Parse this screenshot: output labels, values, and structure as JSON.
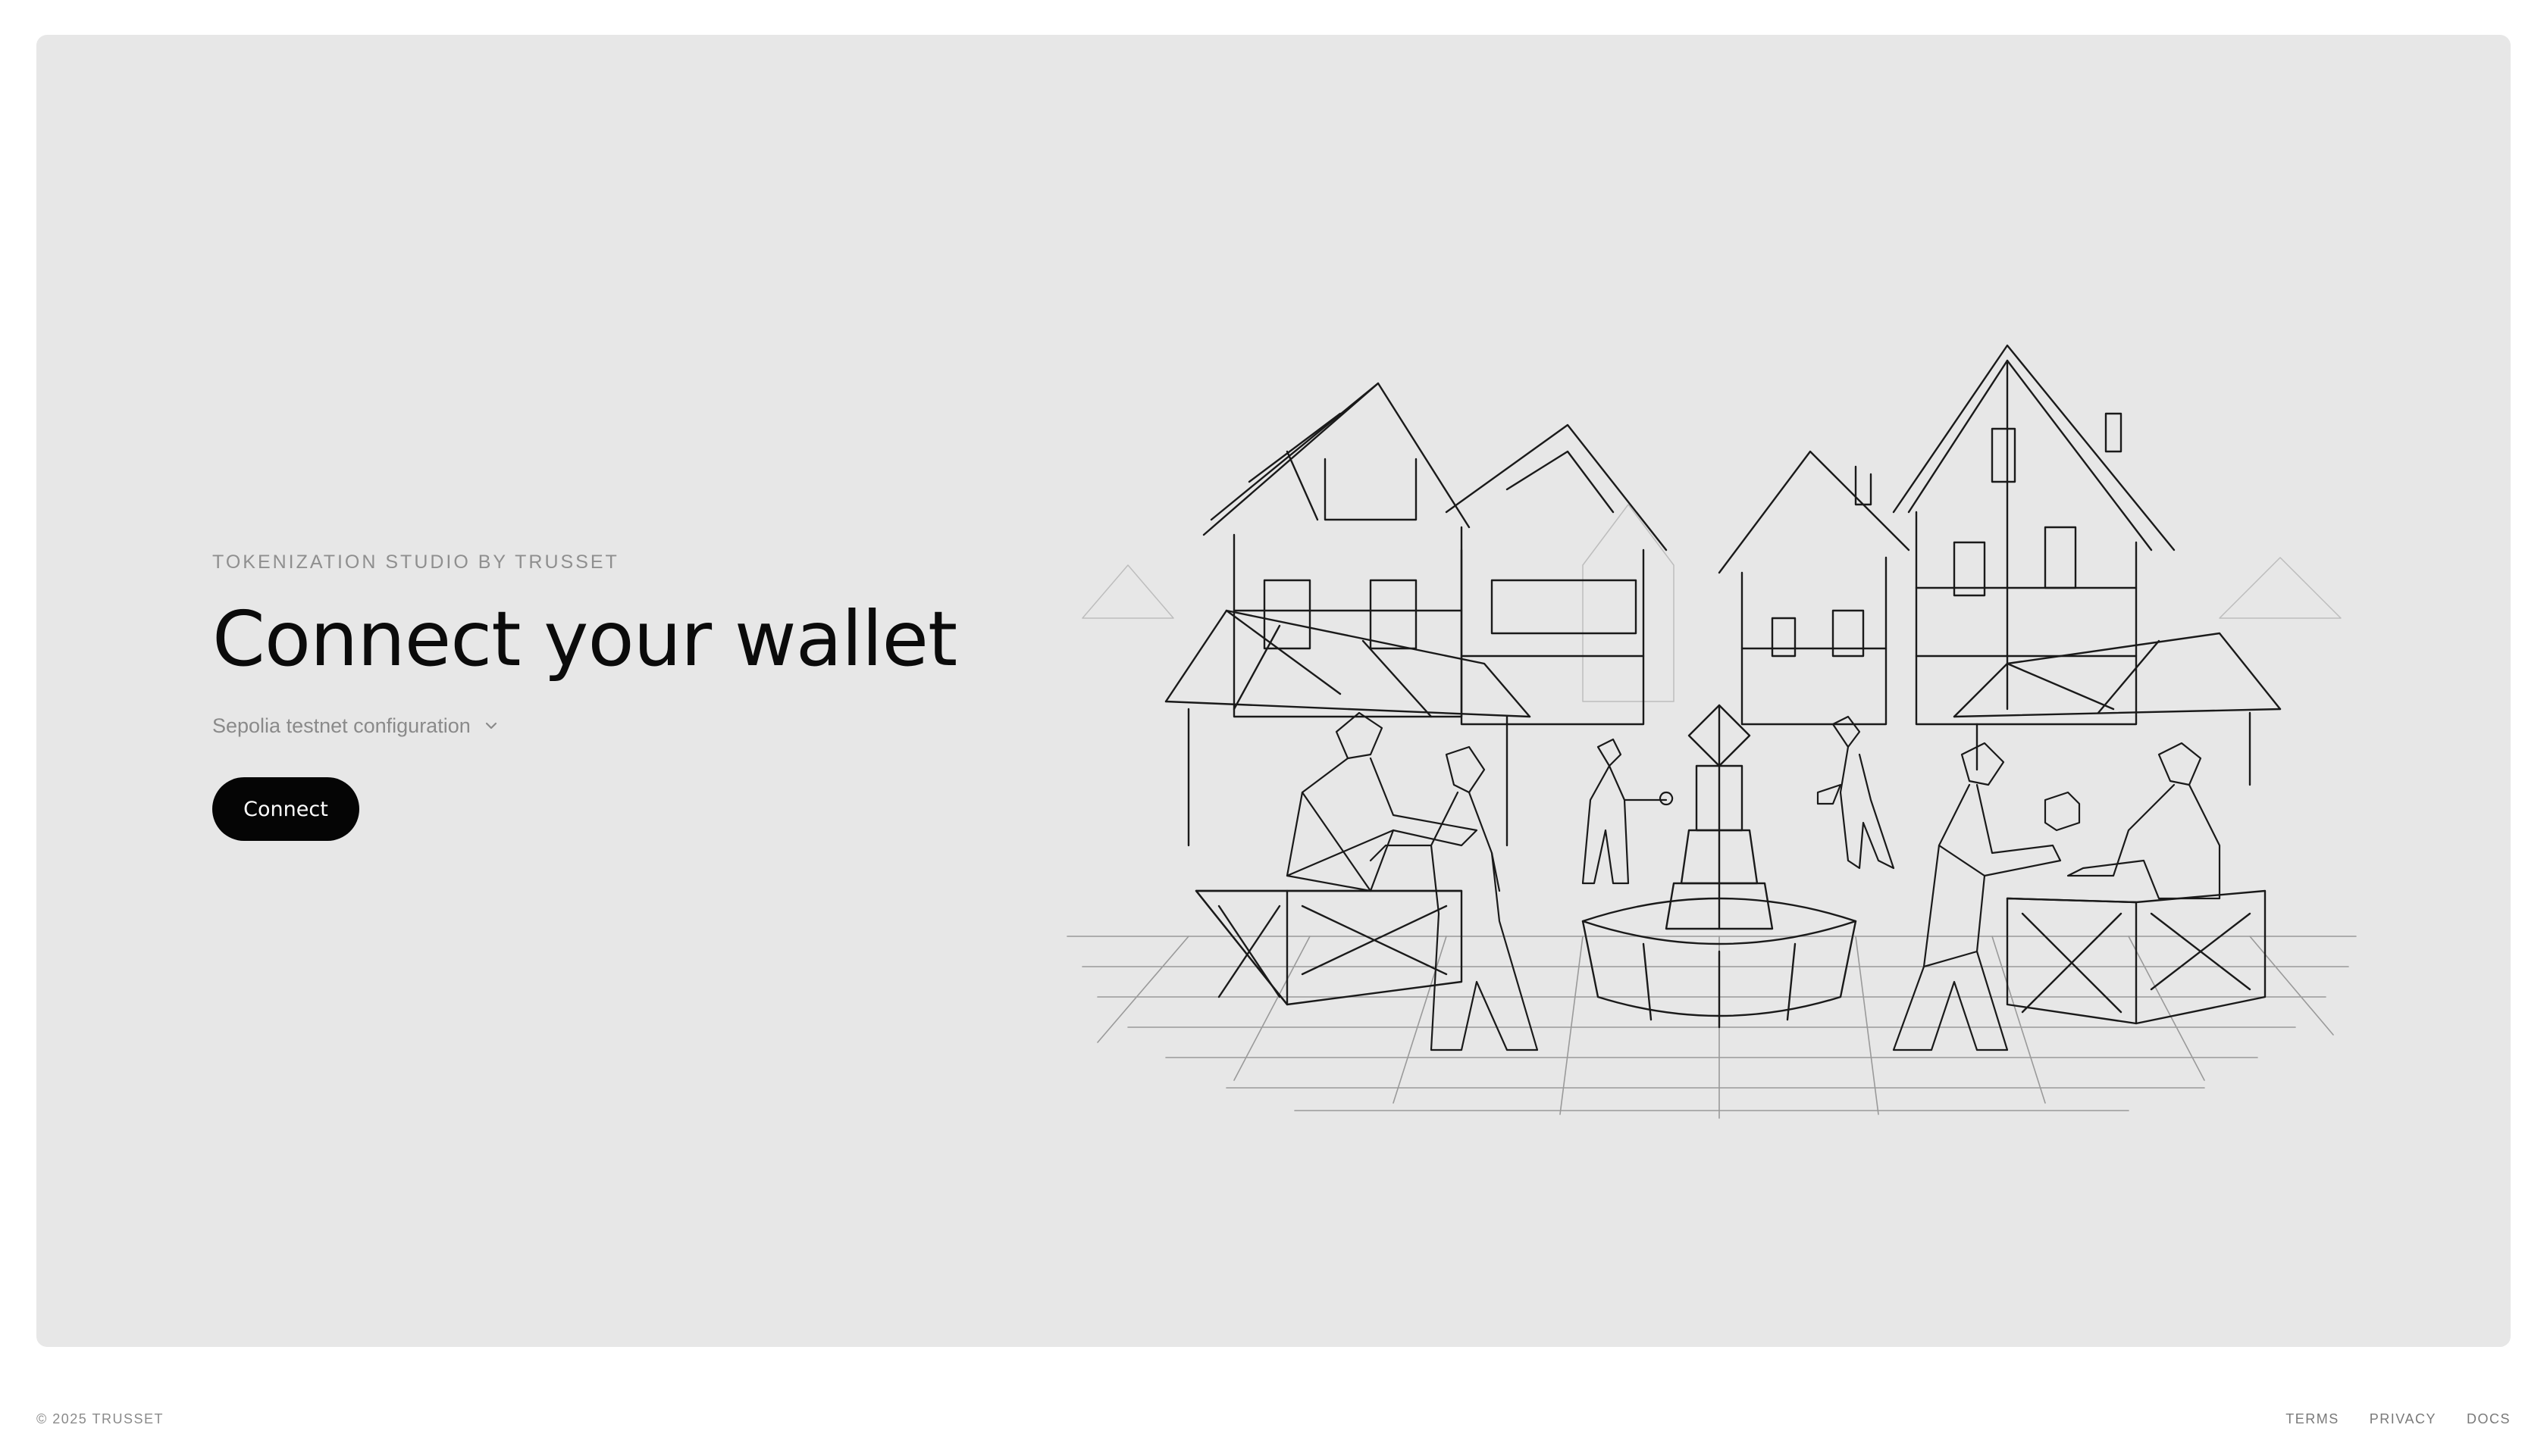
{
  "hero": {
    "eyebrow": "TOKENIZATION STUDIO BY TRUSSET",
    "title": "Connect your wallet",
    "network": {
      "selected": "Sepolia testnet configuration",
      "icon": "chevron-down-icon"
    },
    "connect_button": "Connect",
    "illustration": "market-square-illustration"
  },
  "footer": {
    "copyright": "© 2025 TRUSSET",
    "links": [
      "TERMS",
      "PRIVACY",
      "DOCS"
    ]
  },
  "colors": {
    "card_background": "#e7e7e7",
    "button_background": "#050505",
    "button_text": "#ffffff",
    "muted_text": "#8a8a8a"
  }
}
